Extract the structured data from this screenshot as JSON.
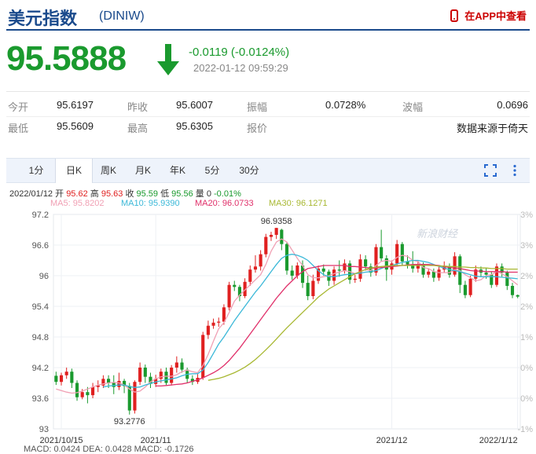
{
  "header": {
    "name": "美元指数",
    "code": "(DINIW)",
    "app_link": "在APP中查看"
  },
  "quote": {
    "price": "95.5888",
    "change": "-0.0119 (-0.0124%)",
    "time": "2022-01-12 09:59:29"
  },
  "stats": {
    "row1": [
      {
        "label": "今开",
        "value": "95.6197"
      },
      {
        "label": "昨收",
        "value": "95.6007"
      },
      {
        "label": "振幅",
        "value": "0.0728%"
      },
      {
        "label": "波幅",
        "value": "0.0696"
      }
    ],
    "row2": [
      {
        "label": "最低",
        "value": "95.5609"
      },
      {
        "label": "最高",
        "value": "95.6305"
      },
      {
        "label": "报价",
        "value": "数据来源于倚天"
      }
    ]
  },
  "tabs": [
    {
      "label": "1分"
    },
    {
      "label": "日K",
      "active": true
    },
    {
      "label": "周K"
    },
    {
      "label": "月K"
    },
    {
      "label": "年K"
    },
    {
      "label": "5分"
    },
    {
      "label": "30分"
    }
  ],
  "info": {
    "date": "2022/01/12",
    "open_label": "开",
    "open": "95.62",
    "high_label": "高",
    "high": "95.63",
    "close_label": "收",
    "close": "95.59",
    "low_label": "低",
    "low": "95.56",
    "volume_label": "量",
    "volume": "0",
    "pct": "-0.01%"
  },
  "ma_legend": [
    {
      "label": "MA5: 95.8202",
      "color": "#f0a0b4"
    },
    {
      "label": "MA10: 95.9390",
      "color": "#3bb8d8"
    },
    {
      "label": "MA20: 96.0733",
      "color": "#e0306a"
    },
    {
      "label": "MA30: 96.1271",
      "color": "#a8b832"
    }
  ],
  "colors": {
    "up": "#e02020",
    "down": "#1a9a2e",
    "brand": "#1a4a8c"
  },
  "watermark": "新浪财经",
  "bottom_clip": "MACD: 0.0424  DEA: 0.0428  MACD: -0.1726",
  "chart_data": {
    "type": "candlestick",
    "x_tick_labels": [
      "2021/10/15",
      "2021/11",
      "2021/12",
      "2022/1/12"
    ],
    "y_tick_labels": [
      "97.2",
      "96.6",
      "96",
      "95.4",
      "94.8",
      "94.2",
      "93.6",
      "93"
    ],
    "ylim": [
      93,
      97.2
    ],
    "pct_tick_labels": [
      "3%",
      "3%",
      "2%",
      "2%",
      "1%",
      "0%",
      "0%",
      "-1%"
    ],
    "annotations": [
      {
        "text": "96.9358",
        "value": 96.9358
      },
      {
        "text": "93.2776",
        "value": 93.2776
      }
    ],
    "candles": [
      [
        94.04,
        93.92,
        94.12,
        93.86
      ],
      [
        93.92,
        94.05,
        94.1,
        93.85
      ],
      [
        94.05,
        94.12,
        94.2,
        93.98
      ],
      [
        94.12,
        93.9,
        94.18,
        93.8
      ],
      [
        93.9,
        93.62,
        93.95,
        93.55
      ],
      [
        93.62,
        93.72,
        93.78,
        93.58
      ],
      [
        93.72,
        93.66,
        93.82,
        93.5
      ],
      [
        93.66,
        93.82,
        93.9,
        93.6
      ],
      [
        93.82,
        93.85,
        93.95,
        93.72
      ],
      [
        93.85,
        93.98,
        94.05,
        93.8
      ],
      [
        93.98,
        93.9,
        94.05,
        93.8
      ],
      [
        93.9,
        93.82,
        94.05,
        93.68
      ],
      [
        93.82,
        93.94,
        94.1,
        93.76
      ],
      [
        93.94,
        93.84,
        93.98,
        93.7
      ],
      [
        93.84,
        93.36,
        93.9,
        93.28
      ],
      [
        93.36,
        93.92,
        93.95,
        93.3
      ],
      [
        93.92,
        94.2,
        94.3,
        93.86
      ],
      [
        94.2,
        94.02,
        94.26,
        93.9
      ],
      [
        94.02,
        93.88,
        94.1,
        93.8
      ],
      [
        93.88,
        93.98,
        94.06,
        93.82
      ],
      [
        93.98,
        94.12,
        94.18,
        93.9
      ],
      [
        94.12,
        93.9,
        94.2,
        93.86
      ],
      [
        93.9,
        94.2,
        94.25,
        93.85
      ],
      [
        94.2,
        94.3,
        94.42,
        94.1
      ],
      [
        94.3,
        94.16,
        94.38,
        94.1
      ],
      [
        94.16,
        93.98,
        94.2,
        93.9
      ],
      [
        93.98,
        93.92,
        94.05,
        93.86
      ],
      [
        93.92,
        94.0,
        94.08,
        93.88
      ],
      [
        94.0,
        94.84,
        94.9,
        93.96
      ],
      [
        94.84,
        95.02,
        95.12,
        94.76
      ],
      [
        95.02,
        95.08,
        95.16,
        94.96
      ],
      [
        95.08,
        95.1,
        95.18,
        95.0
      ],
      [
        95.1,
        95.38,
        95.44,
        95.04
      ],
      [
        95.38,
        95.82,
        95.88,
        95.32
      ],
      [
        95.82,
        95.78,
        95.9,
        95.7
      ],
      [
        95.78,
        95.6,
        95.82,
        95.5
      ],
      [
        95.6,
        95.88,
        95.95,
        95.56
      ],
      [
        95.88,
        96.12,
        96.2,
        95.8
      ],
      [
        96.12,
        96.18,
        96.4,
        96.06
      ],
      [
        96.18,
        96.42,
        96.5,
        96.1
      ],
      [
        96.42,
        96.76,
        96.82,
        96.36
      ],
      [
        96.76,
        96.8,
        96.86,
        96.68
      ],
      [
        96.8,
        96.9358,
        96.9358,
        96.72
      ],
      [
        96.9,
        96.62,
        96.92,
        96.5
      ],
      [
        96.62,
        96.1,
        96.66,
        96.02
      ],
      [
        96.1,
        96.0,
        96.2,
        95.92
      ],
      [
        96.0,
        96.2,
        96.26,
        95.94
      ],
      [
        96.2,
        95.86,
        96.3,
        95.76
      ],
      [
        95.86,
        95.6,
        96.0,
        95.52
      ],
      [
        95.6,
        95.9,
        96.02,
        95.54
      ],
      [
        95.9,
        96.14,
        96.2,
        95.84
      ],
      [
        96.14,
        96.08,
        96.22,
        96.0
      ],
      [
        96.08,
        95.9,
        96.12,
        95.8
      ],
      [
        95.9,
        96.12,
        96.18,
        95.82
      ],
      [
        96.12,
        96.1,
        96.3,
        95.98
      ],
      [
        96.1,
        96.24,
        96.32,
        96.04
      ],
      [
        96.24,
        95.92,
        96.3,
        95.84
      ],
      [
        95.92,
        95.94,
        96.02,
        95.86
      ],
      [
        95.94,
        96.32,
        96.42,
        95.88
      ],
      [
        96.32,
        96.18,
        96.4,
        96.1
      ],
      [
        96.18,
        96.06,
        96.24,
        95.98
      ],
      [
        96.06,
        96.56,
        96.62,
        96.0
      ],
      [
        96.56,
        96.34,
        96.9,
        96.28
      ],
      [
        96.34,
        96.12,
        96.4,
        95.9
      ],
      [
        96.12,
        96.24,
        96.3,
        96.02
      ],
      [
        96.24,
        96.62,
        96.7,
        96.18
      ],
      [
        96.62,
        96.28,
        96.66,
        96.2
      ],
      [
        96.28,
        96.22,
        96.4,
        96.14
      ],
      [
        96.22,
        96.14,
        96.48,
        96.06
      ],
      [
        96.14,
        96.22,
        96.3,
        96.06
      ],
      [
        96.22,
        96.02,
        96.26,
        95.96
      ],
      [
        96.02,
        96.08,
        96.14,
        95.96
      ],
      [
        96.08,
        95.96,
        96.14,
        95.88
      ],
      [
        95.96,
        96.12,
        96.2,
        95.9
      ],
      [
        96.12,
        96.18,
        96.28,
        96.06
      ],
      [
        96.18,
        96.02,
        96.24,
        95.96
      ],
      [
        96.02,
        96.38,
        96.46,
        95.98
      ],
      [
        96.38,
        95.82,
        96.42,
        95.66
      ],
      [
        95.82,
        95.62,
        95.9,
        95.56
      ],
      [
        95.62,
        95.94,
        96.0,
        95.58
      ],
      [
        95.94,
        96.12,
        96.2,
        95.88
      ],
      [
        96.12,
        96.06,
        96.18,
        95.98
      ],
      [
        96.06,
        96.02,
        96.16,
        95.94
      ],
      [
        96.02,
        95.82,
        96.08,
        95.76
      ],
      [
        95.82,
        96.18,
        96.24,
        95.78
      ],
      [
        96.18,
        96.06,
        96.24,
        95.98
      ],
      [
        96.06,
        95.8,
        96.1,
        95.72
      ],
      [
        95.8,
        95.62,
        95.86,
        95.56
      ],
      [
        95.62,
        95.59,
        95.63,
        95.56
      ]
    ],
    "ma5": [
      93.78,
      93.75,
      93.72,
      93.7,
      93.71,
      93.74,
      93.78,
      93.82,
      93.86,
      93.88,
      93.9,
      93.91,
      93.9,
      93.86,
      93.78,
      93.72,
      93.74,
      93.82,
      93.92,
      93.98,
      94.02,
      94.03,
      94.03,
      94.06,
      94.12,
      94.15,
      94.12,
      94.1,
      94.24,
      94.46,
      94.72,
      94.96,
      95.08,
      95.28,
      95.5,
      95.62,
      95.72,
      95.82,
      95.92,
      96.02,
      96.22,
      96.48,
      96.66,
      96.72,
      96.66,
      96.5,
      96.34,
      96.2,
      96.02,
      95.96,
      95.96,
      95.98,
      96.0,
      96.04,
      96.07,
      96.1,
      96.08,
      96.04,
      96.08,
      96.12,
      96.1,
      96.2,
      96.28,
      96.3,
      96.28,
      96.36,
      96.4,
      96.38,
      96.3,
      96.28,
      96.16,
      96.14,
      96.08,
      96.06,
      96.06,
      96.06,
      96.12,
      96.1,
      96.02,
      95.96,
      95.9,
      95.92,
      96.0,
      96.02,
      96.08,
      96.04,
      95.98,
      95.9,
      95.82
    ],
    "ma10": [
      null,
      null,
      null,
      null,
      null,
      null,
      null,
      null,
      null,
      93.82,
      93.84,
      93.85,
      93.86,
      93.86,
      93.83,
      93.81,
      93.82,
      93.86,
      93.89,
      93.92,
      93.94,
      93.96,
      93.98,
      94.0,
      94.04,
      94.07,
      94.08,
      94.08,
      94.15,
      94.3,
      94.48,
      94.66,
      94.8,
      94.96,
      95.12,
      95.26,
      95.4,
      95.54,
      95.68,
      95.8,
      95.94,
      96.08,
      96.22,
      96.34,
      96.4,
      96.42,
      96.4,
      96.36,
      96.3,
      96.2,
      96.1,
      96.02,
      95.98,
      95.98,
      96.0,
      96.02,
      96.03,
      96.04,
      96.05,
      96.07,
      96.08,
      96.1,
      96.14,
      96.18,
      96.2,
      96.23,
      96.26,
      96.28,
      96.3,
      96.3,
      96.28,
      96.26,
      96.22,
      96.18,
      96.15,
      96.12,
      96.1,
      96.08,
      96.05,
      96.02,
      95.99,
      95.98,
      95.98,
      95.98,
      95.98,
      95.97,
      95.96,
      95.95,
      95.94
    ],
    "ma20": [
      null,
      null,
      null,
      null,
      null,
      null,
      null,
      null,
      null,
      null,
      null,
      null,
      null,
      null,
      null,
      null,
      null,
      null,
      null,
      93.84,
      93.84,
      93.85,
      93.86,
      93.87,
      93.88,
      93.9,
      93.93,
      93.96,
      94.0,
      94.05,
      94.1,
      94.16,
      94.24,
      94.34,
      94.46,
      94.58,
      94.72,
      94.86,
      95.0,
      95.14,
      95.28,
      95.42,
      95.56,
      95.68,
      95.8,
      95.9,
      96.0,
      96.08,
      96.14,
      96.16,
      96.18,
      96.2,
      96.2,
      96.2,
      96.2,
      96.2,
      96.18,
      96.18,
      96.17,
      96.16,
      96.15,
      96.15,
      96.16,
      96.17,
      96.18,
      96.19,
      96.2,
      96.21,
      96.22,
      96.22,
      96.22,
      96.22,
      96.21,
      96.2,
      96.18,
      96.16,
      96.15,
      96.14,
      96.12,
      96.1,
      96.09,
      96.09,
      96.08,
      96.08,
      96.08,
      96.08,
      96.07,
      96.07,
      96.07
    ],
    "ma30": [
      null,
      null,
      null,
      null,
      null,
      null,
      null,
      null,
      null,
      null,
      null,
      null,
      null,
      null,
      null,
      null,
      null,
      null,
      null,
      null,
      null,
      null,
      null,
      null,
      null,
      null,
      null,
      null,
      null,
      93.95,
      93.97,
      93.99,
      94.02,
      94.06,
      94.1,
      94.15,
      94.21,
      94.28,
      94.36,
      94.45,
      94.55,
      94.65,
      94.76,
      94.87,
      94.98,
      95.08,
      95.18,
      95.28,
      95.38,
      95.48,
      95.58,
      95.66,
      95.74,
      95.8,
      95.86,
      95.92,
      95.98,
      96.04,
      96.08,
      96.12,
      96.15,
      96.17,
      96.18,
      96.19,
      96.2,
      96.2,
      96.2,
      96.2,
      96.2,
      96.2,
      96.2,
      96.2,
      96.2,
      96.19,
      96.19,
      96.18,
      96.18,
      96.17,
      96.17,
      96.16,
      96.16,
      96.15,
      96.15,
      96.14,
      96.14,
      96.14,
      96.13,
      96.13,
      96.13
    ]
  }
}
